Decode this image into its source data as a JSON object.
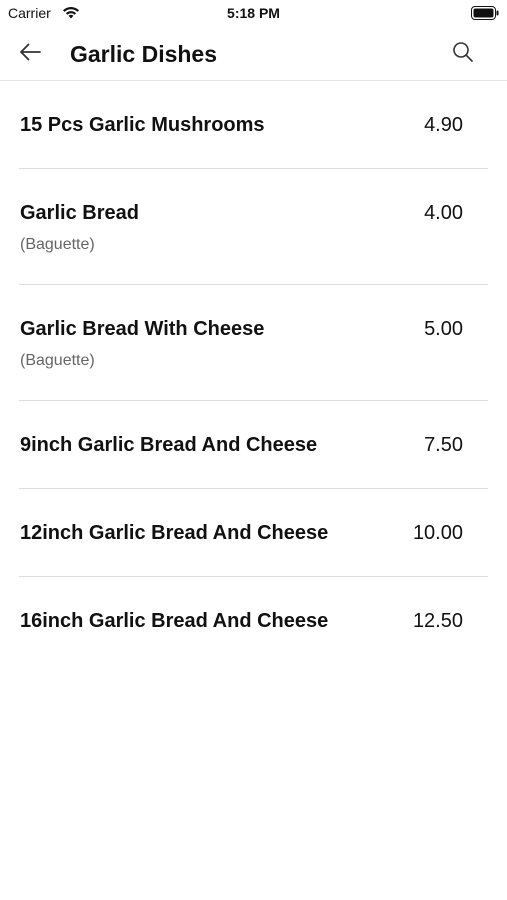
{
  "status_bar": {
    "carrier": "Carrier",
    "time": "5:18 PM"
  },
  "header": {
    "title": "Garlic Dishes",
    "back_icon": "arrow-left-icon",
    "search_icon": "search-icon"
  },
  "items": [
    {
      "name": "15 Pcs Garlic Mushrooms",
      "price": "4.90"
    },
    {
      "name": "Garlic Bread",
      "sub": "(Baguette)",
      "price": "4.00"
    },
    {
      "name": "Garlic Bread With Cheese",
      "sub": "(Baguette)",
      "price": "5.00"
    },
    {
      "name": "9inch Garlic Bread And Cheese",
      "price": "7.50"
    },
    {
      "name": "12inch Garlic Bread And Cheese",
      "price": "10.00"
    },
    {
      "name": "16inch Garlic Bread And Cheese",
      "price": "12.50"
    }
  ]
}
